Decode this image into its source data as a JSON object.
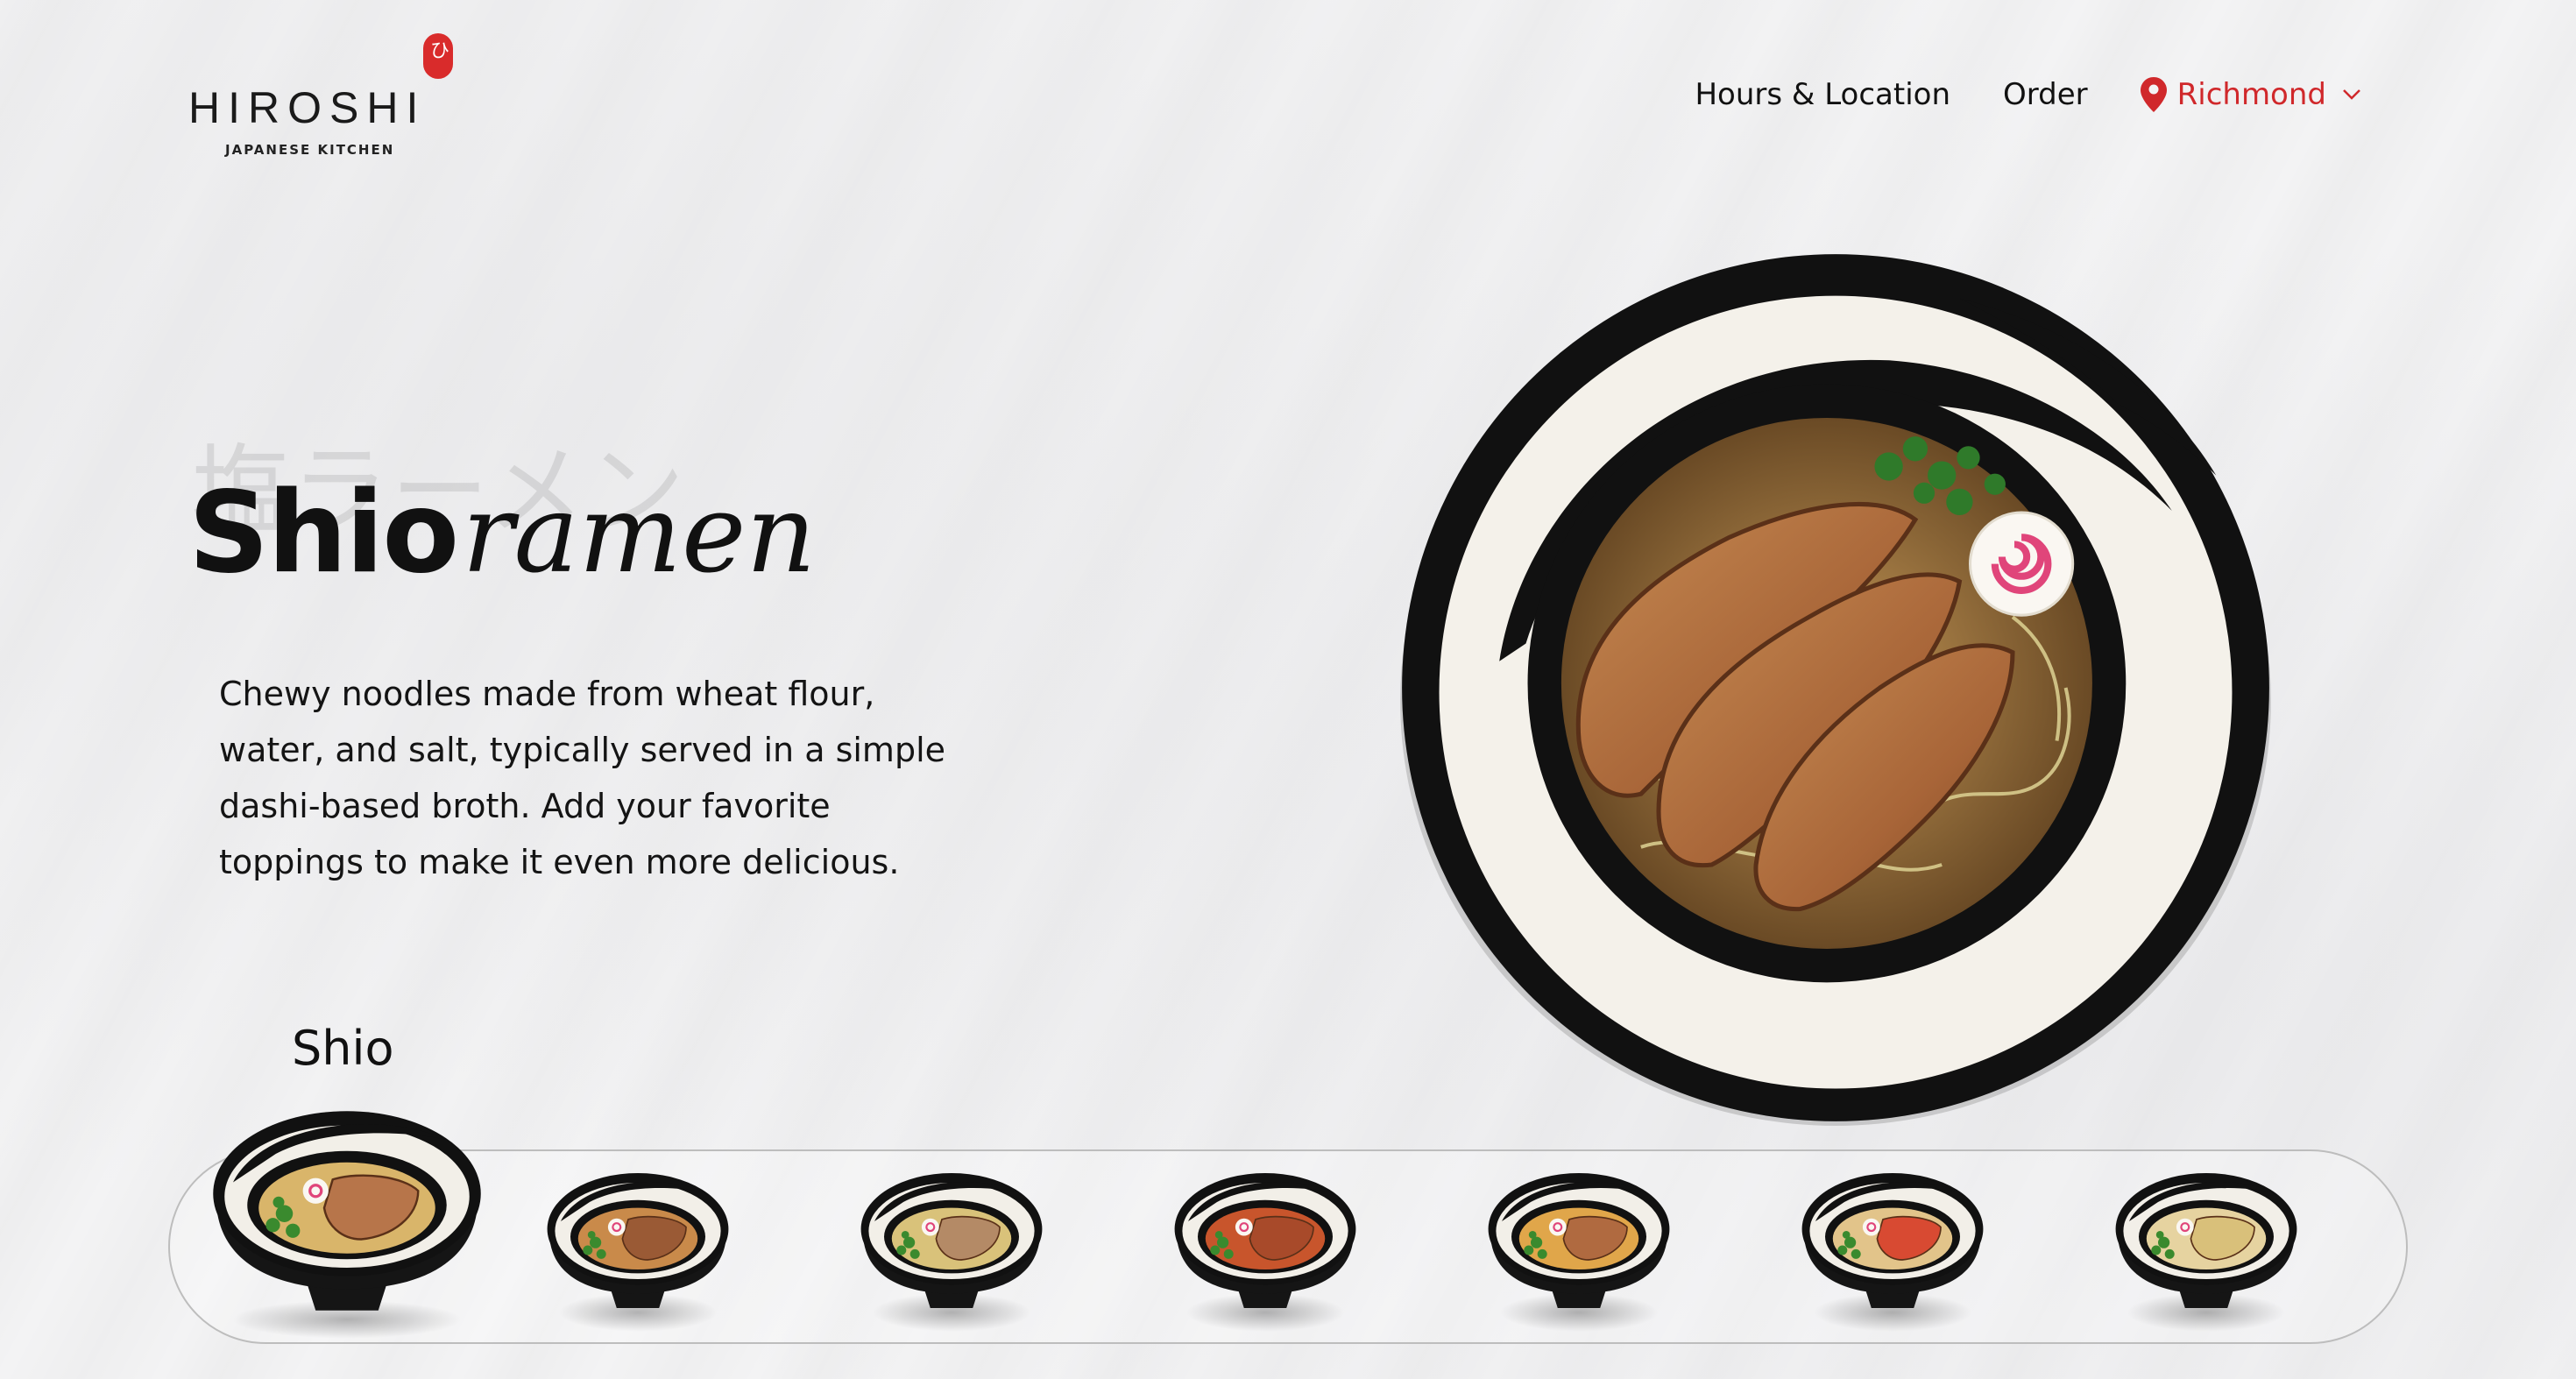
{
  "brand": {
    "name": "HIROSHI",
    "subtitle": "JAPANESE KITCHEN",
    "badge_glyph": "ひ",
    "accent": "#d0282b"
  },
  "nav": {
    "hours": "Hours & Location",
    "order": "Order",
    "location": "Richmond",
    "location_icon": "map-pin-icon",
    "dropdown_icon": "chevron-down-icon"
  },
  "hero": {
    "jp_title": "塩ラーメン",
    "title_bold": "Shio",
    "title_italic": "ramen",
    "description": "Chewy noodles made from wheat flour, water, and salt, typically served in a simple dashi-based broth. Add your favorite toppings to make it even more delicious."
  },
  "carousel": {
    "selected_label": "Shio",
    "items": [
      {
        "broth": "#d9b56a",
        "topping": "#b7754a",
        "selected": true
      },
      {
        "broth": "#c98a4a",
        "topping": "#9a5a35",
        "selected": false
      },
      {
        "broth": "#d9c27a",
        "topping": "#b48a66",
        "selected": false
      },
      {
        "broth": "#c8552c",
        "topping": "#a84a2a",
        "selected": false
      },
      {
        "broth": "#e0a64a",
        "topping": "#b06a40",
        "selected": false
      },
      {
        "broth": "#e2c48a",
        "topping": "#d84a32",
        "selected": false
      },
      {
        "broth": "#e6d3a0",
        "topping": "#d9c07a",
        "selected": false
      }
    ]
  }
}
